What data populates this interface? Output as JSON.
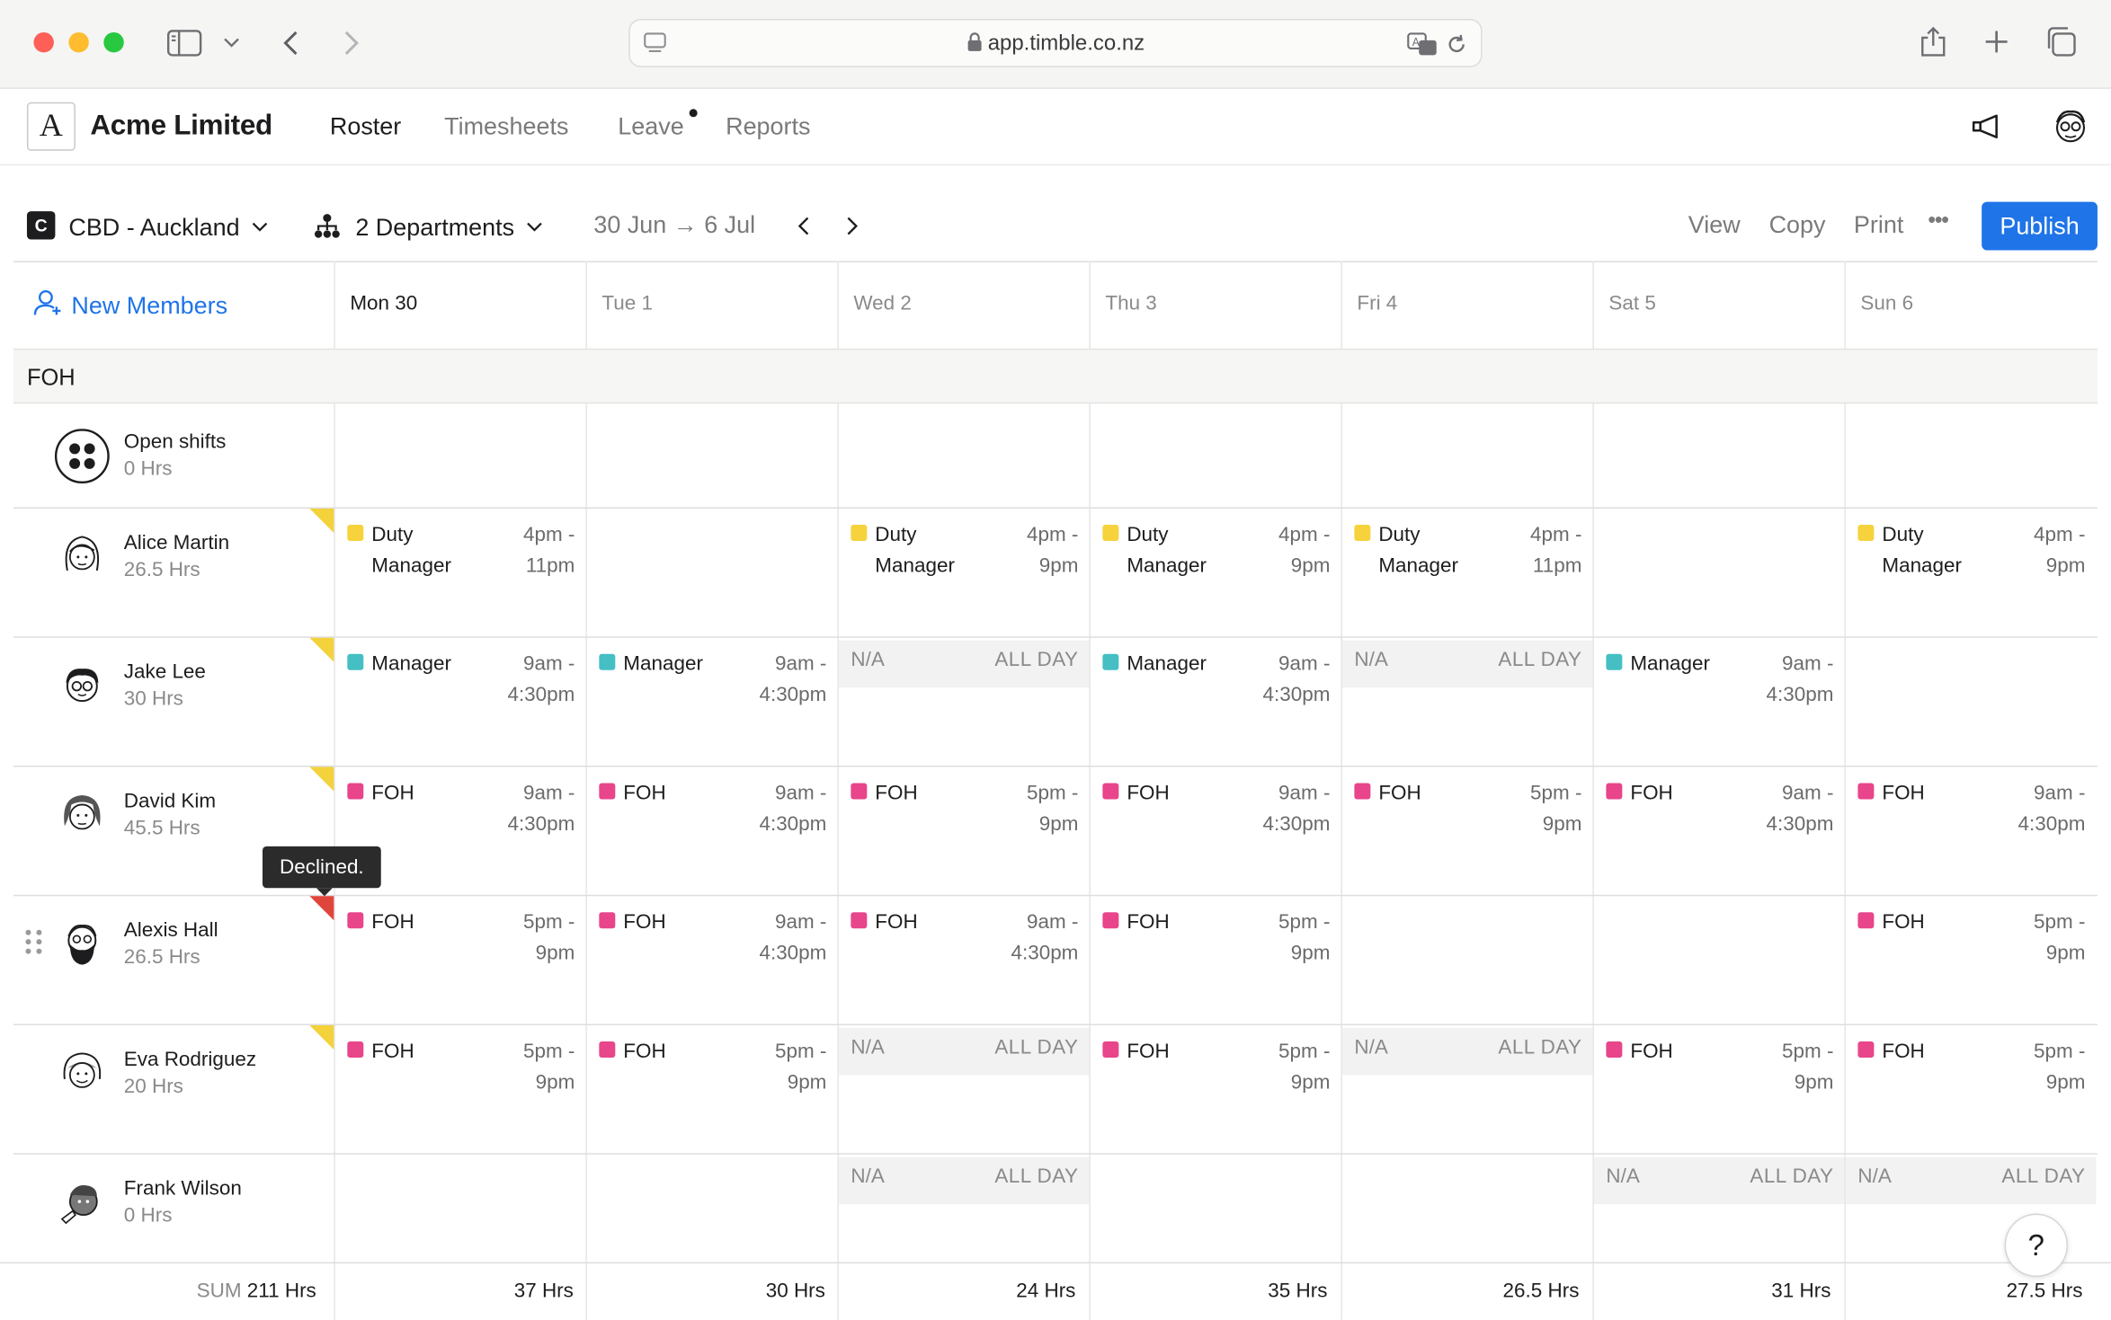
{
  "browser": {
    "url": "app.timble.co.nz"
  },
  "app": {
    "logo_letter": "A",
    "company": "Acme Limited",
    "nav": [
      {
        "label": "Roster",
        "active": true
      },
      {
        "label": "Timesheets",
        "active": false
      },
      {
        "label": "Leave",
        "active": false,
        "has_dot": true
      },
      {
        "label": "Reports",
        "active": false
      }
    ]
  },
  "toolbar": {
    "location_badge": "C",
    "location": "CBD - Auckland",
    "departments": "2 Departments",
    "date_range": "30 Jun → 6 Jul",
    "view_label": "View",
    "copy_label": "Copy",
    "print_label": "Print",
    "more_label": "•••",
    "publish_label": "Publish"
  },
  "grid": {
    "new_members_label": "New Members",
    "days": [
      {
        "label": "Mon 30",
        "today": true
      },
      {
        "label": "Tue 1"
      },
      {
        "label": "Wed 2"
      },
      {
        "label": "Thu 3"
      },
      {
        "label": "Fri 4"
      },
      {
        "label": "Sat 5"
      },
      {
        "label": "Sun 6"
      }
    ],
    "section": "FOH",
    "colors": {
      "duty_manager": "#f6d23c",
      "manager": "#45bfc4",
      "foh": "#e8458b",
      "accent": "#1f74e8"
    },
    "open_shifts": {
      "name": "Open shifts",
      "hours": "0 Hrs"
    },
    "members": [
      {
        "name": "Alice Martin",
        "hours": "26.5 Hrs",
        "flag": "yellow",
        "cells": [
          {
            "type": "shift",
            "role": "Duty Manager",
            "time1": "4pm -",
            "time2": "11pm",
            "color": "duty_manager"
          },
          null,
          {
            "type": "shift",
            "role": "Duty Manager",
            "time1": "4pm -",
            "time2": "9pm",
            "color": "duty_manager"
          },
          {
            "type": "shift",
            "role": "Duty Manager",
            "time1": "4pm -",
            "time2": "9pm",
            "color": "duty_manager"
          },
          {
            "type": "shift",
            "role": "Duty Manager",
            "time1": "4pm -",
            "time2": "11pm",
            "color": "duty_manager"
          },
          null,
          {
            "type": "shift",
            "role": "Duty Manager",
            "time1": "4pm -",
            "time2": "9pm",
            "color": "duty_manager"
          }
        ]
      },
      {
        "name": "Jake Lee",
        "hours": "30 Hrs",
        "flag": "yellow",
        "cells": [
          {
            "type": "shift",
            "role": "Manager",
            "time1": "9am -",
            "time2": "4:30pm",
            "color": "manager"
          },
          {
            "type": "shift",
            "role": "Manager",
            "time1": "9am -",
            "time2": "4:30pm",
            "color": "manager"
          },
          {
            "type": "na",
            "left": "N/A",
            "right": "ALL DAY"
          },
          {
            "type": "shift",
            "role": "Manager",
            "time1": "9am -",
            "time2": "4:30pm",
            "color": "manager"
          },
          {
            "type": "na",
            "left": "N/A",
            "right": "ALL DAY"
          },
          {
            "type": "shift",
            "role": "Manager",
            "time1": "9am -",
            "time2": "4:30pm",
            "color": "manager"
          },
          null
        ]
      },
      {
        "name": "David Kim",
        "hours": "45.5 Hrs",
        "flag": "yellow",
        "cells": [
          {
            "type": "shift",
            "role": "FOH",
            "time1": "9am -",
            "time2": "4:30pm",
            "color": "foh"
          },
          {
            "type": "shift",
            "role": "FOH",
            "time1": "9am -",
            "time2": "4:30pm",
            "color": "foh"
          },
          {
            "type": "shift",
            "role": "FOH",
            "time1": "5pm -",
            "time2": "9pm",
            "color": "foh"
          },
          {
            "type": "shift",
            "role": "FOH",
            "time1": "9am -",
            "time2": "4:30pm",
            "color": "foh"
          },
          {
            "type": "shift",
            "role": "FOH",
            "time1": "5pm -",
            "time2": "9pm",
            "color": "foh"
          },
          {
            "type": "shift",
            "role": "FOH",
            "time1": "9am -",
            "time2": "4:30pm",
            "color": "foh"
          },
          {
            "type": "shift",
            "role": "FOH",
            "time1": "9am -",
            "time2": "4:30pm",
            "color": "foh"
          }
        ]
      },
      {
        "name": "Alexis Hall",
        "hours": "26.5 Hrs",
        "flag": "red",
        "cells": [
          {
            "type": "shift",
            "role": "FOH",
            "time1": "5pm -",
            "time2": "9pm",
            "color": "foh"
          },
          {
            "type": "shift",
            "role": "FOH",
            "time1": "9am -",
            "time2": "4:30pm",
            "color": "foh"
          },
          {
            "type": "shift",
            "role": "FOH",
            "time1": "9am -",
            "time2": "4:30pm",
            "color": "foh"
          },
          {
            "type": "shift",
            "role": "FOH",
            "time1": "5pm -",
            "time2": "9pm",
            "color": "foh"
          },
          null,
          null,
          {
            "type": "shift",
            "role": "FOH",
            "time1": "5pm -",
            "time2": "9pm",
            "color": "foh"
          }
        ]
      },
      {
        "name": "Eva Rodriguez",
        "hours": "20 Hrs",
        "flag": "yellow",
        "cells": [
          {
            "type": "shift",
            "role": "FOH",
            "time1": "5pm -",
            "time2": "9pm",
            "color": "foh"
          },
          {
            "type": "shift",
            "role": "FOH",
            "time1": "5pm -",
            "time2": "9pm",
            "color": "foh"
          },
          {
            "type": "na",
            "left": "N/A",
            "right": "ALL DAY"
          },
          {
            "type": "shift",
            "role": "FOH",
            "time1": "5pm -",
            "time2": "9pm",
            "color": "foh"
          },
          {
            "type": "na",
            "left": "N/A",
            "right": "ALL DAY"
          },
          {
            "type": "shift",
            "role": "FOH",
            "time1": "5pm -",
            "time2": "9pm",
            "color": "foh"
          },
          {
            "type": "shift",
            "role": "FOH",
            "time1": "5pm -",
            "time2": "9pm",
            "color": "foh"
          }
        ]
      },
      {
        "name": "Frank Wilson",
        "hours": "0 Hrs",
        "flag": null,
        "cells": [
          null,
          null,
          {
            "type": "na",
            "left": "N/A",
            "right": "ALL DAY"
          },
          null,
          null,
          {
            "type": "na",
            "left": "N/A",
            "right": "ALL DAY"
          },
          {
            "type": "na",
            "left": "N/A",
            "right": "ALL DAY"
          }
        ]
      }
    ],
    "tooltip": "Declined.",
    "totals": {
      "sum_label": "SUM",
      "sum_value": "211 Hrs",
      "days": [
        "37 Hrs",
        "30 Hrs",
        "24 Hrs",
        "35 Hrs",
        "26.5 Hrs",
        "31 Hrs",
        "27.5 Hrs"
      ]
    }
  },
  "help_label": "?"
}
